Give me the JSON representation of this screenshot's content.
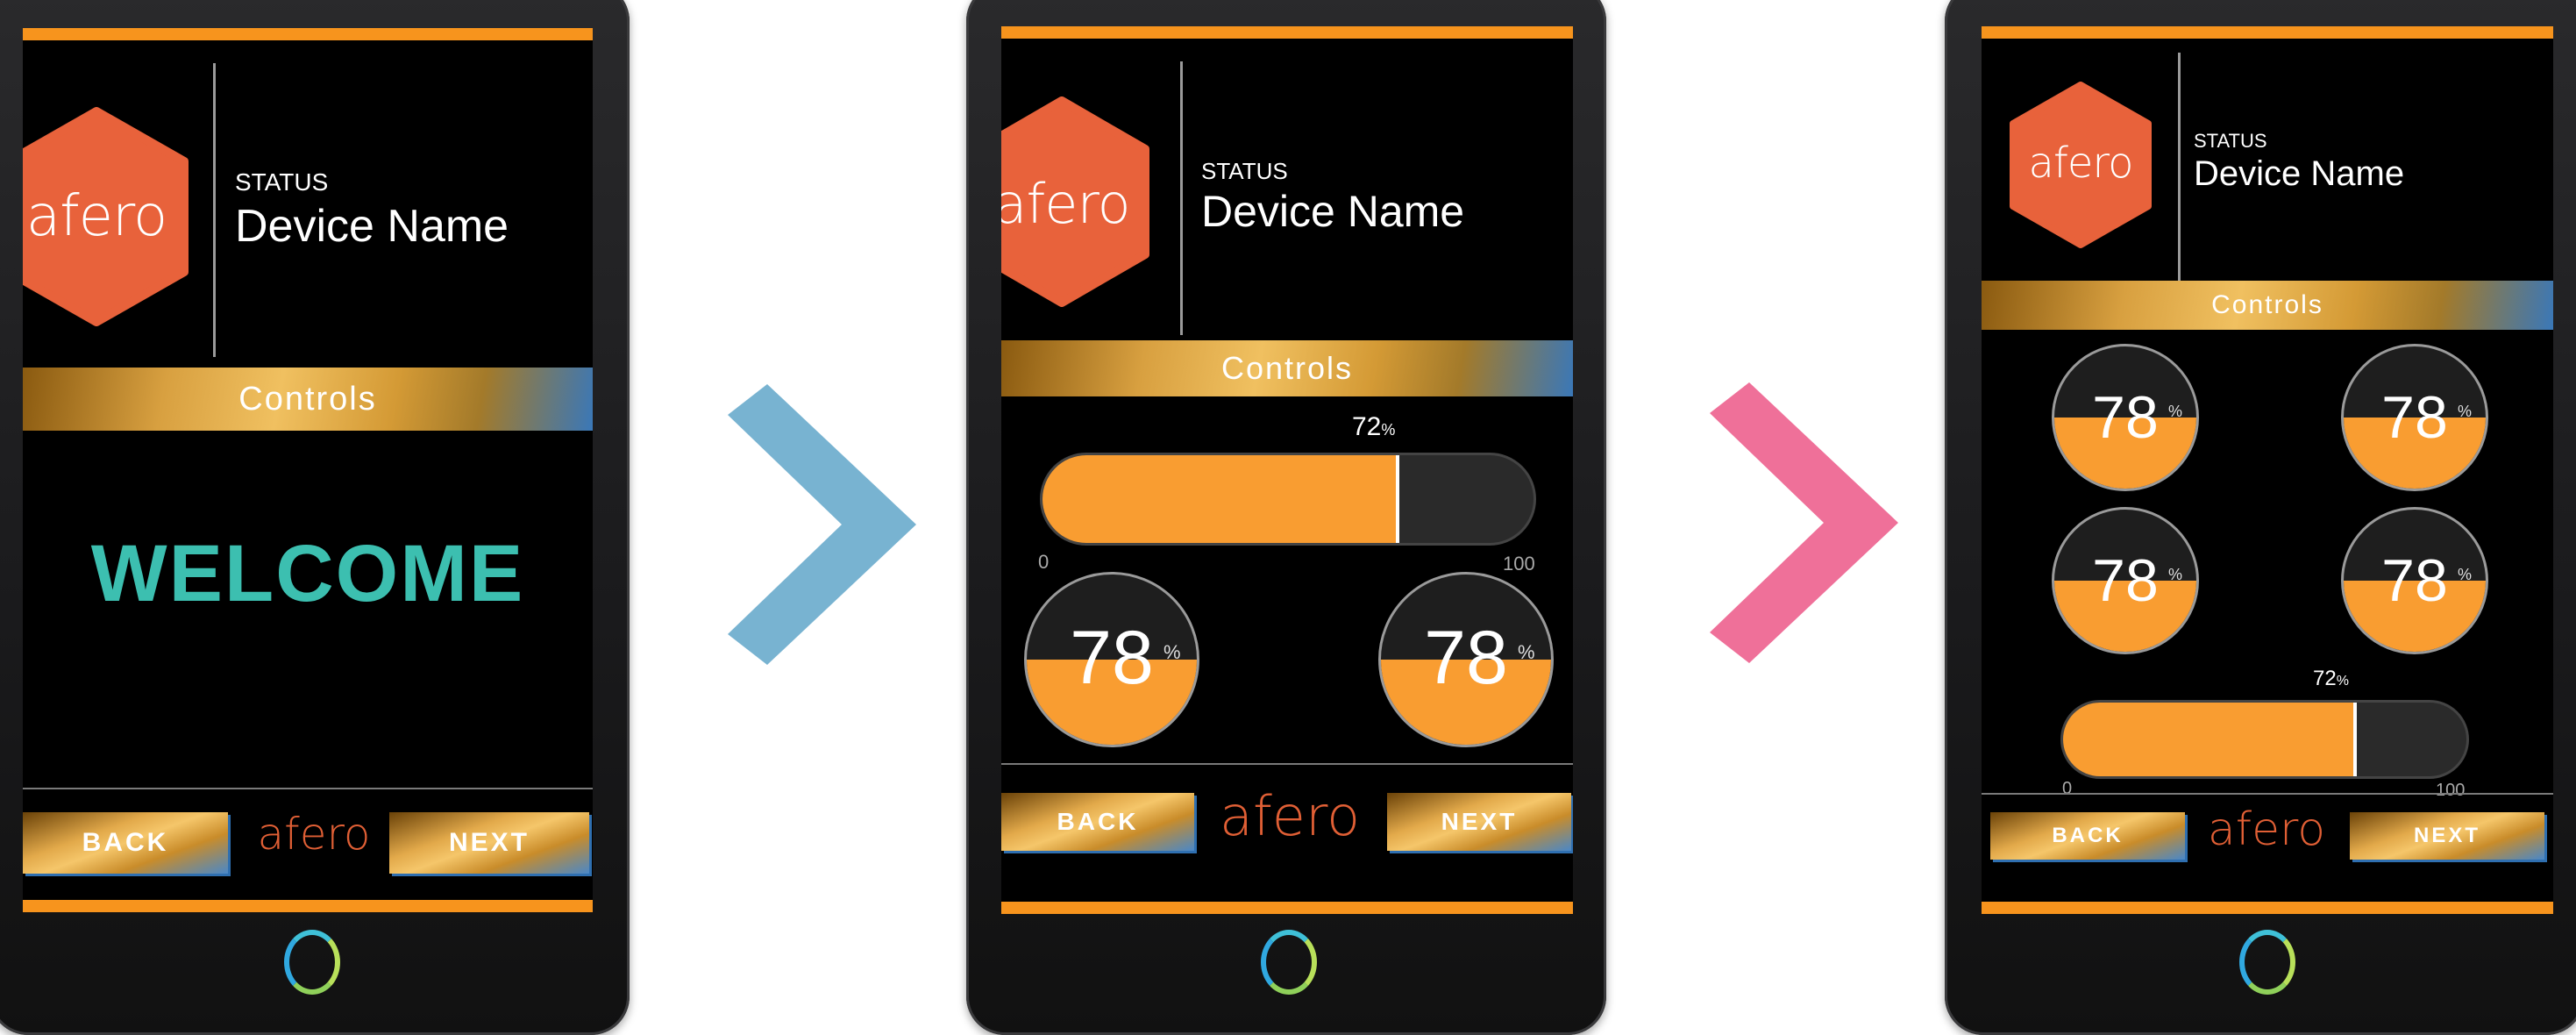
{
  "brand": {
    "logo_text": "afero",
    "color": "#e8623b"
  },
  "header": {
    "status": "STATUS",
    "device_name": "Device Name"
  },
  "controls_label": "Controls",
  "welcome": "WELCOME",
  "nav": {
    "back": "BACK",
    "next": "NEXT"
  },
  "slider": {
    "value": "72",
    "unit": "%",
    "min": "0",
    "max": "100",
    "fraction": 0.72
  },
  "gauge": {
    "value": "78",
    "unit": "%",
    "fraction": 0.5
  },
  "arrows": [
    {
      "icon": "chevron-right-icon",
      "color": "#78b3d1"
    },
    {
      "icon": "chevron-right-icon",
      "color": "#ef7099"
    }
  ],
  "colors": {
    "accent_orange": "#f7941d",
    "welcome_teal": "#3cbfb0",
    "fill_orange": "#f99d31"
  }
}
